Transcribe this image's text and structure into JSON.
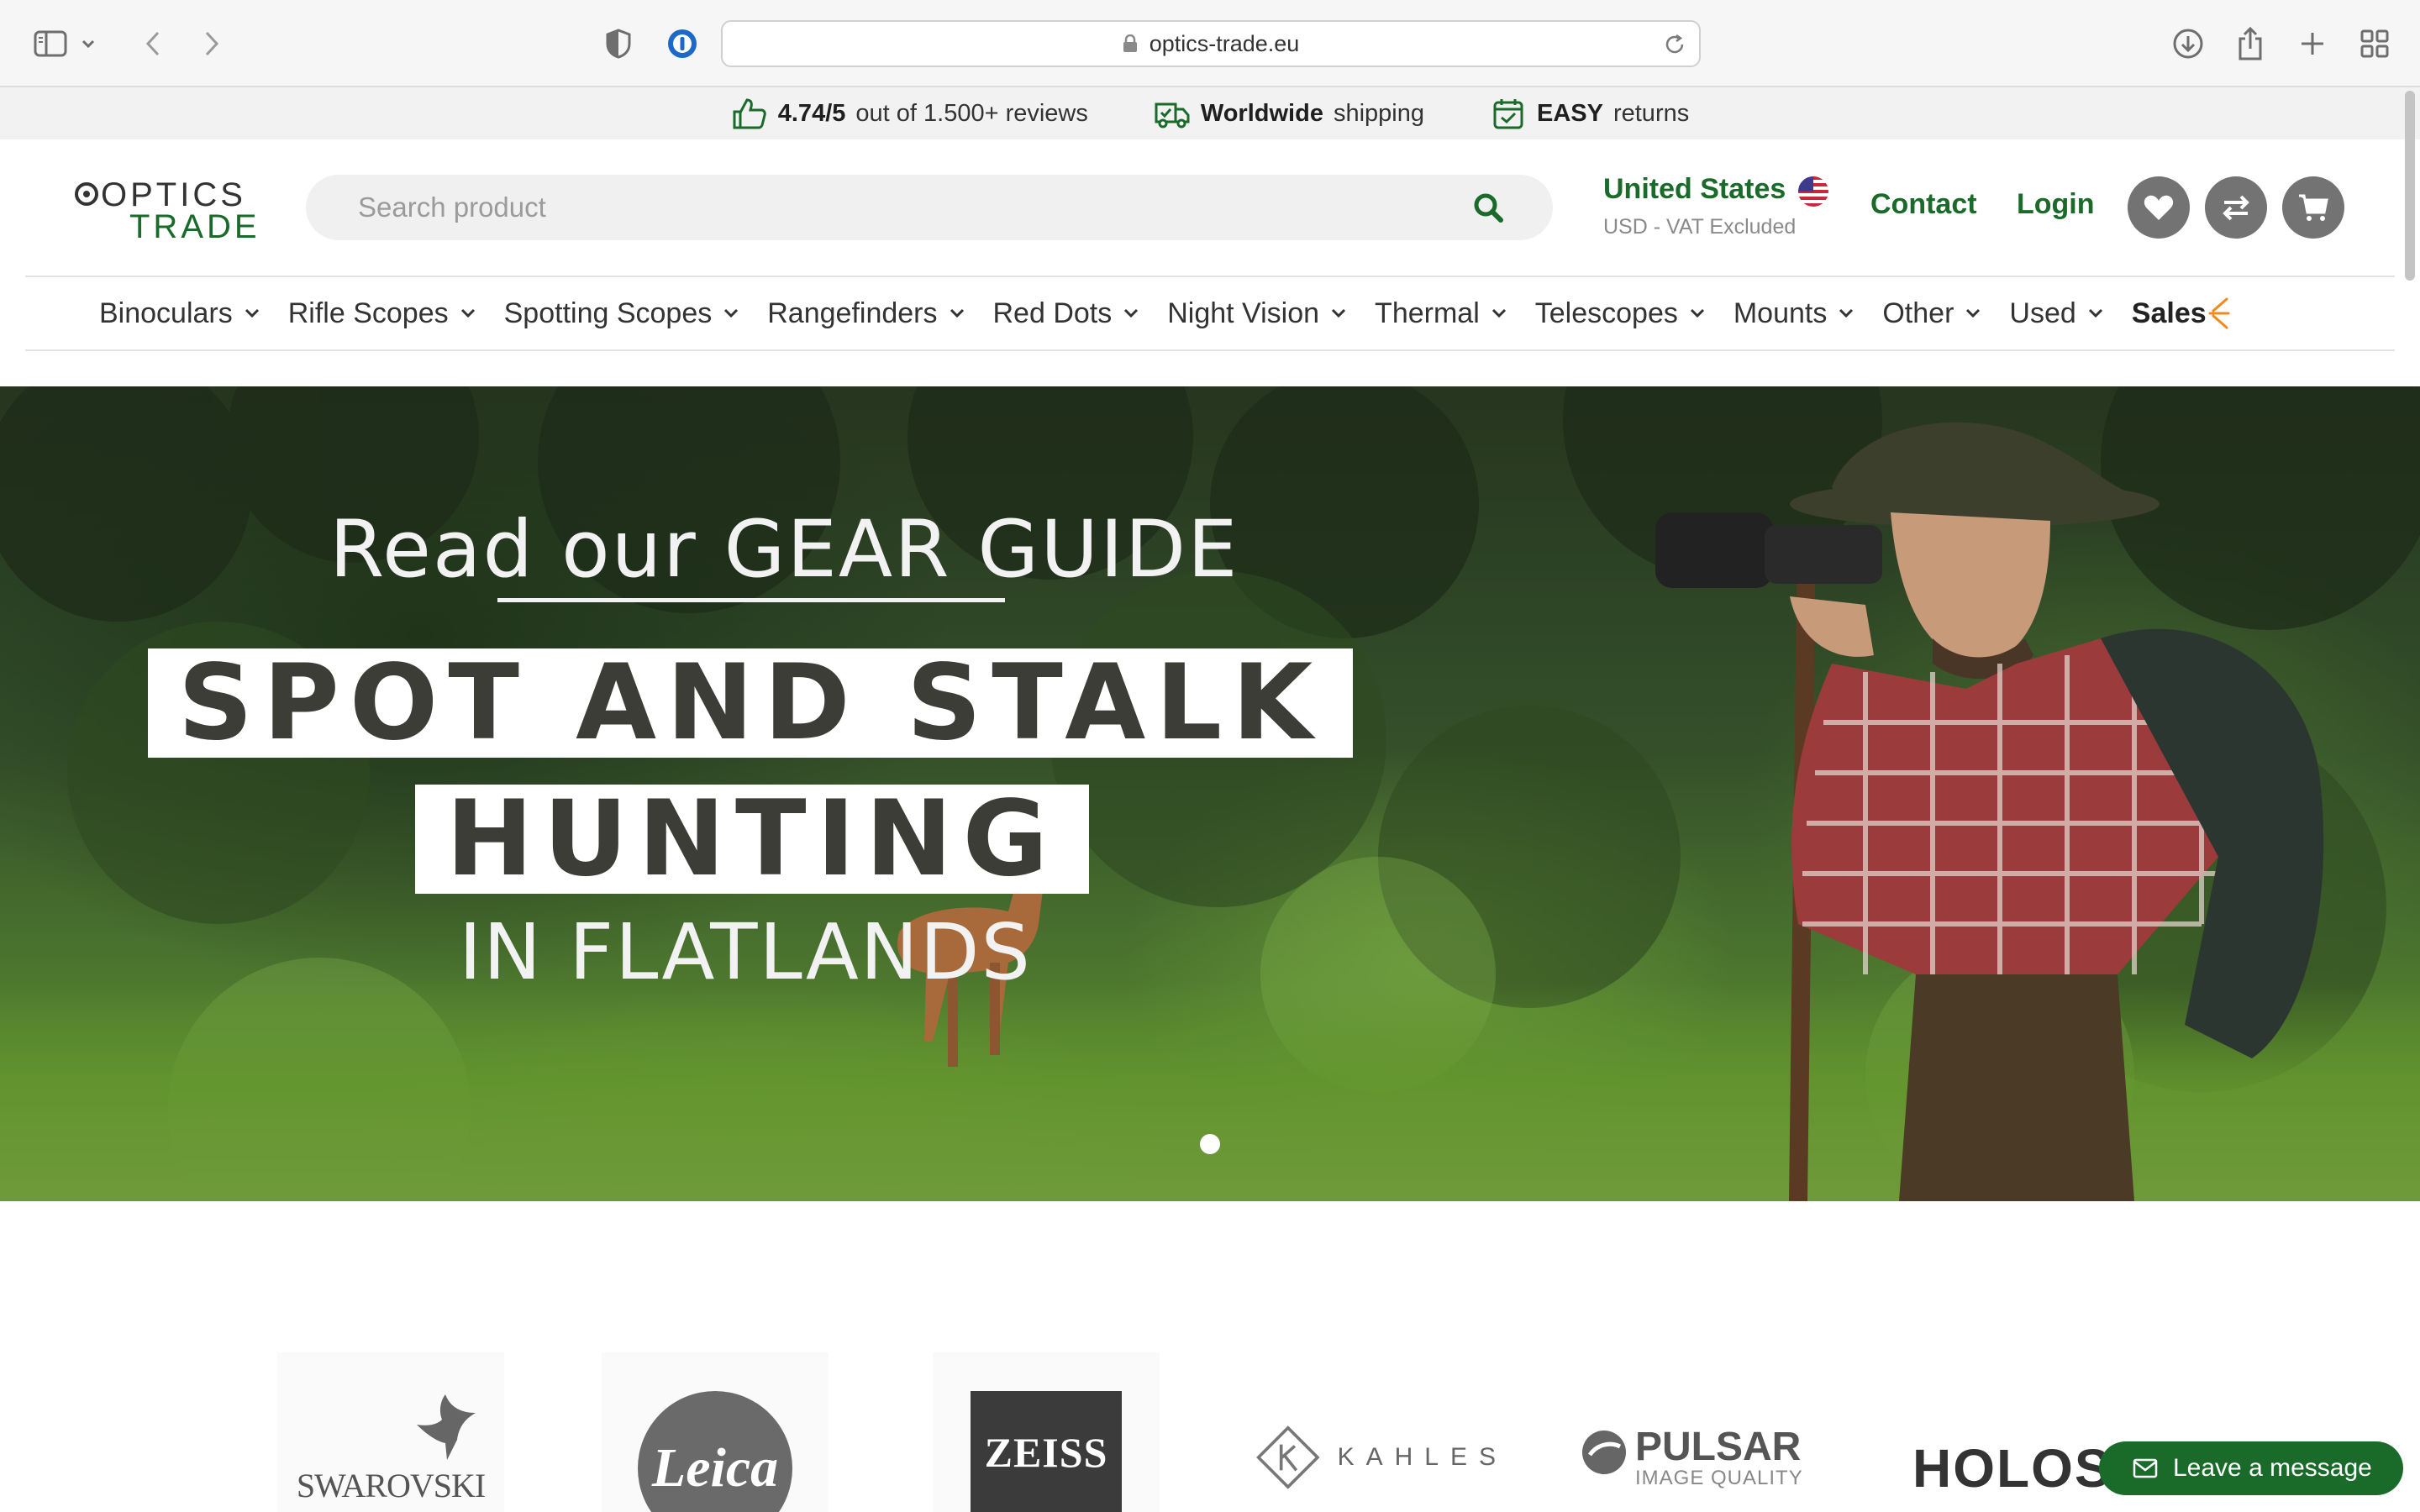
{
  "browser": {
    "url": "optics-trade.eu",
    "icons": [
      "sidebar-icon",
      "chevron-down-icon",
      "back-icon",
      "forward-icon",
      "shield-icon",
      "password-manager-icon",
      "lock-icon",
      "reload-icon",
      "download-icon",
      "share-icon",
      "plus-icon",
      "tab-overview-icon"
    ]
  },
  "promo": {
    "rating_value": "4.74/5",
    "rating_text": "out of 1.500+ reviews",
    "shipping_bold": "Worldwide",
    "shipping_text": "shipping",
    "returns_bold": "EASY",
    "returns_text": "returns"
  },
  "header": {
    "logo_line1": "OPTICS",
    "logo_line2": "TRADE",
    "search_placeholder": "Search product",
    "country": "United States",
    "currency": "USD - VAT Excluded",
    "contact": "Contact",
    "login": "Login",
    "brand_color": "#1a6b2a"
  },
  "nav": {
    "items": [
      "Binoculars",
      "Rifle Scopes",
      "Spotting Scopes",
      "Rangefinders",
      "Red Dots",
      "Night Vision",
      "Thermal",
      "Telescopes",
      "Mounts",
      "Other",
      "Used"
    ],
    "sales": "Sales"
  },
  "hero": {
    "kicker": "Read our GEAR GUIDE",
    "line1": "SPOT AND STALK",
    "line2": "HUNTING",
    "line3": "IN FLATLANDS",
    "slides": 1,
    "active_slide": 1
  },
  "brands": {
    "swarovski": "SWAROVSKI",
    "leica": "Leica",
    "zeiss": "ZEISS",
    "kahles": "KAHLES",
    "pulsar": "PULSAR",
    "pulsar_tag": "IMAGE QUALITY",
    "holosun": "HOLOSU"
  },
  "chat": {
    "label": "Leave a message"
  }
}
